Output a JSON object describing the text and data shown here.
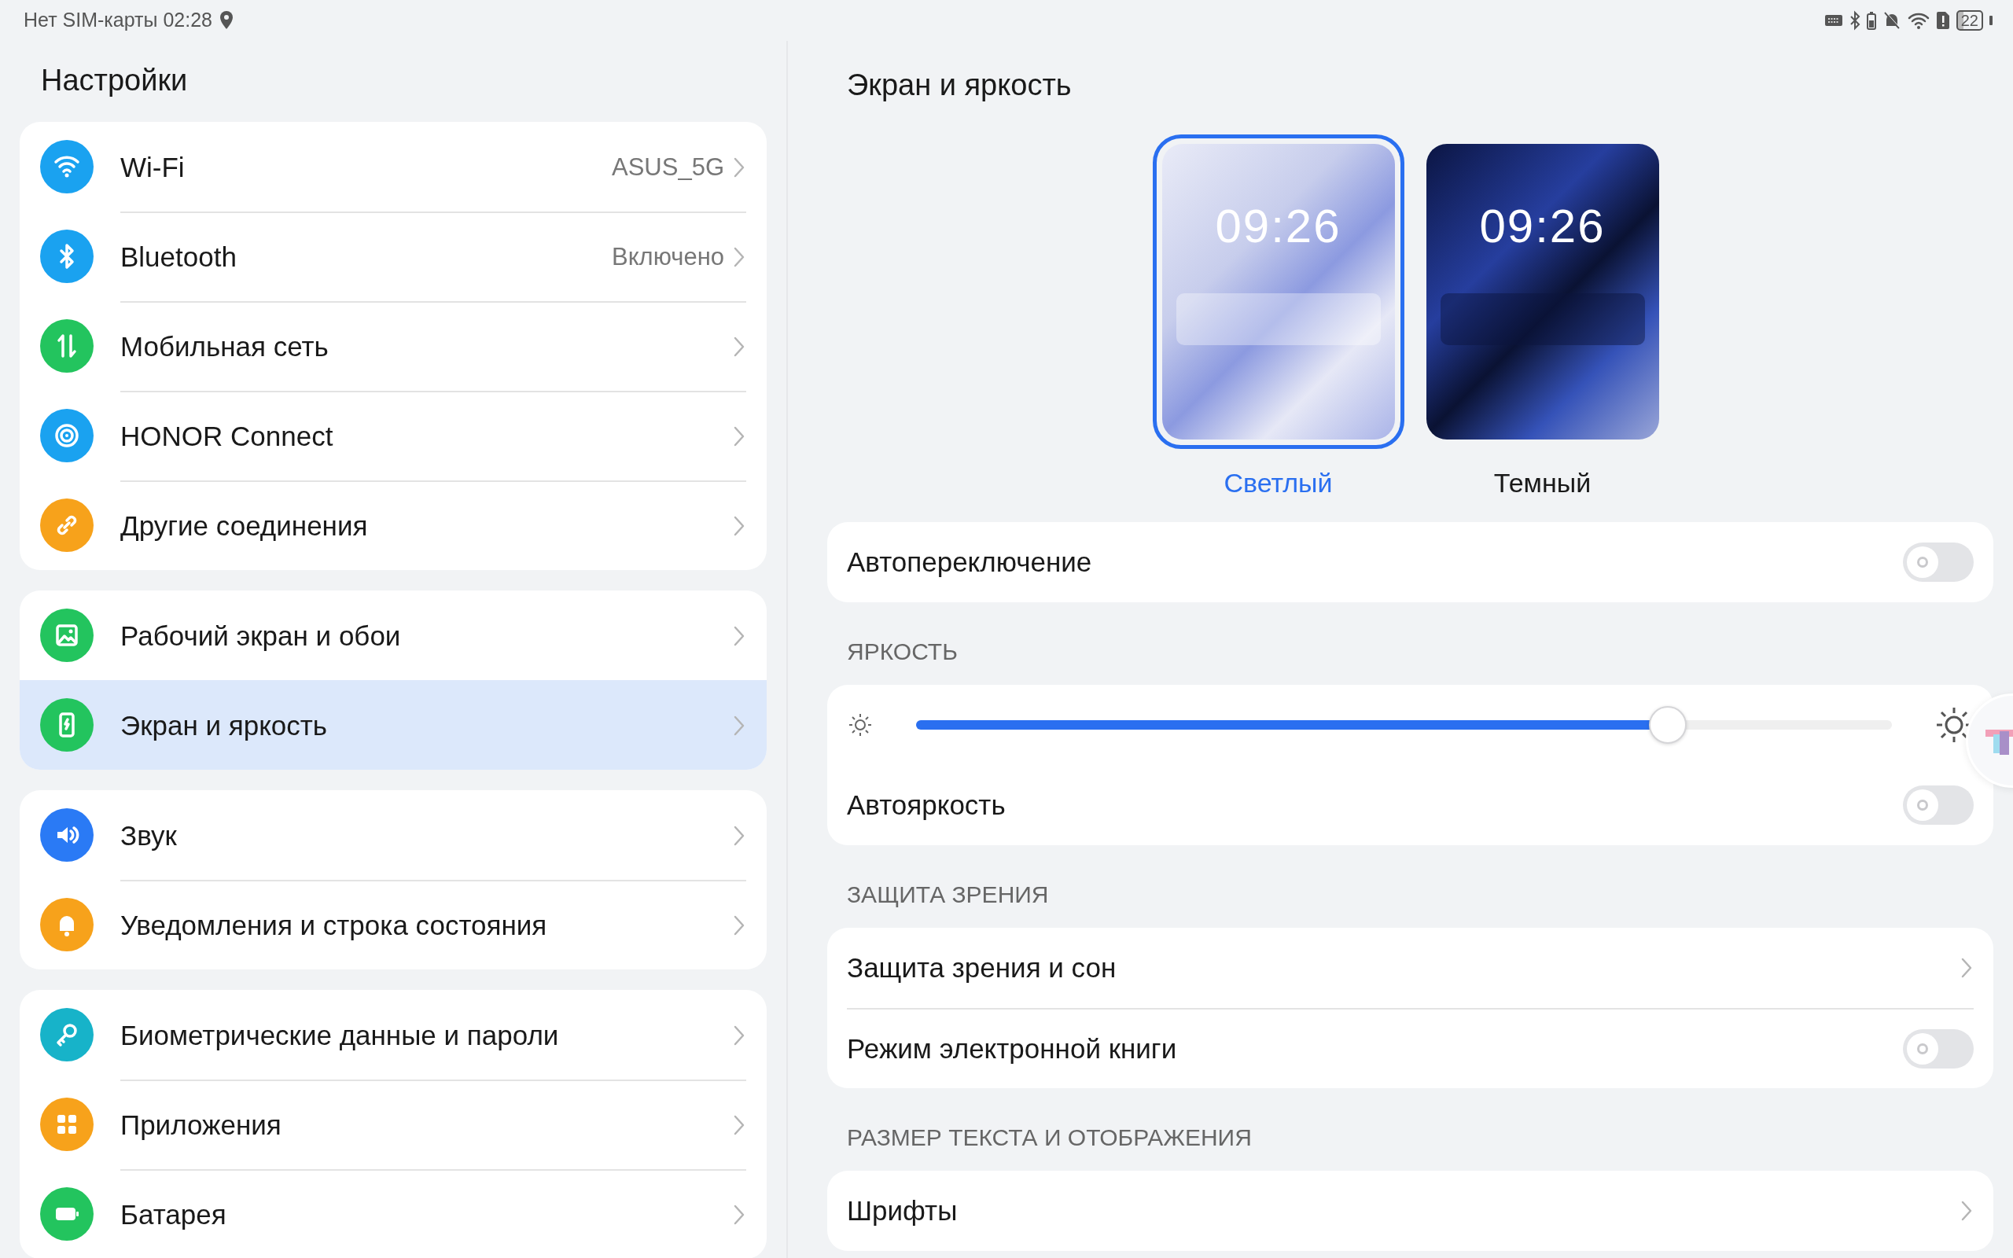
{
  "status_bar": {
    "text": "Нет SIM-карты 02:28",
    "battery": "22"
  },
  "sidebar": {
    "title": "Настройки",
    "groups": [
      {
        "items": [
          {
            "label": "Wi-Fi",
            "value": "ASUS_5G",
            "color": "#1aa2f0",
            "selected": false
          },
          {
            "label": "Bluetooth",
            "value": "Включено",
            "color": "#1aa2f0",
            "selected": false
          },
          {
            "label": "Мобильная сеть",
            "color": "#23c45e",
            "selected": false
          },
          {
            "label": "HONOR Connect",
            "color": "#1aa2f0",
            "selected": false
          },
          {
            "label": "Другие соединения",
            "color": "#f7a21b",
            "selected": false
          }
        ]
      },
      {
        "items": [
          {
            "label": "Рабочий экран и обои",
            "color": "#23c45e",
            "selected": false
          },
          {
            "label": "Экран и яркость",
            "color": "#23c45e",
            "selected": true
          }
        ]
      },
      {
        "items": [
          {
            "label": "Звук",
            "color": "#2a7af5",
            "selected": false
          },
          {
            "label": "Уведомления и строка состояния",
            "color": "#f7a21b",
            "selected": false
          }
        ]
      },
      {
        "items": [
          {
            "label": "Биометрические данные и пароли",
            "color": "#17b3c9",
            "selected": false
          },
          {
            "label": "Приложения",
            "color": "#f7a21b",
            "selected": false
          },
          {
            "label": "Батарея",
            "color": "#23c45e",
            "selected": false
          }
        ]
      }
    ]
  },
  "detail": {
    "title": "Экран и яркость",
    "themes": [
      {
        "label": "Светлый",
        "kind": "light",
        "clock": "09:26",
        "selected": true
      },
      {
        "label": "Темный",
        "kind": "dark",
        "clock": "09:26",
        "selected": false
      }
    ],
    "auto_switch": {
      "label": "Автопереключение",
      "on": false
    },
    "brightness": {
      "header": "ЯРКОСТЬ",
      "level": 0.77,
      "auto_label": "Автояркость",
      "auto_on": false
    },
    "sections": [
      {
        "header": "ЗАЩИТА ЗРЕНИЯ",
        "items": [
          {
            "label": "Защита зрения и сон",
            "kind": "link"
          },
          {
            "label": "Режим электронной книги",
            "kind": "toggle",
            "on": false
          }
        ]
      },
      {
        "header": "РАЗМЕР ТЕКСТА И ОТОБРАЖЕНИЯ",
        "items": [
          {
            "label": "Шрифты",
            "kind": "link"
          }
        ]
      }
    ]
  }
}
